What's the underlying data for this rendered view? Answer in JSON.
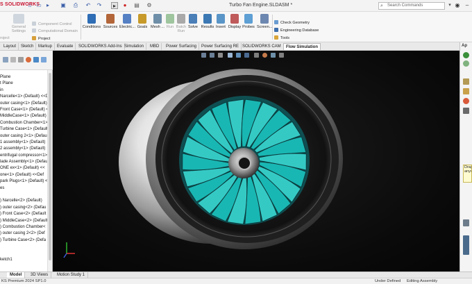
{
  "titlebar": {
    "brand": "S SOLIDWORKS",
    "document_title": "Turbo Fan Engine.SLDASM *",
    "search_placeholder": "Search Commands",
    "quick_access_icons": [
      "home-icon",
      "new-icon",
      "open-icon",
      "save-icon",
      "print-icon",
      "undo-icon",
      "select-icon",
      "rebuild-icon",
      "options-icon"
    ]
  },
  "ribbon": {
    "left_group": {
      "general_settings": "General Settings",
      "project": "Project",
      "component_control": "Component Control",
      "computational_domain": "Computational Domain"
    },
    "buttons": [
      {
        "label": "Conditions",
        "color": "#2f6db5"
      },
      {
        "label": "Sources",
        "color": "#b3663a"
      },
      {
        "label": "Electric...",
        "color": "#5580c4"
      },
      {
        "label": "Goals",
        "color": "#c79a2a"
      },
      {
        "label": "Mesh ...",
        "color": "#6f8fa8"
      },
      {
        "label": "Run",
        "color": "#9ec59e"
      },
      {
        "label": "Batch Run",
        "color": "#a9a9a9"
      },
      {
        "label": "Solve",
        "color": "#4a7fb8"
      },
      {
        "label": "Results",
        "color": "#3c79b4"
      },
      {
        "label": "Insert",
        "color": "#5a95c7"
      },
      {
        "label": "Display",
        "color": "#bf5b5b"
      },
      {
        "label": "Probes",
        "color": "#5e9fd4"
      },
      {
        "label": "Screen...",
        "color": "#6d88b0"
      }
    ],
    "right_group": {
      "check_geometry": "Check Geometry",
      "engineering_database": "Engineering Database",
      "tools": "Tools"
    }
  },
  "tabs": [
    {
      "label": "Layout",
      "active": false
    },
    {
      "label": "Sketch",
      "active": false
    },
    {
      "label": "Markup",
      "active": false
    },
    {
      "label": "Evaluate",
      "active": false
    },
    {
      "label": "SOLIDWORKS Add-Ins",
      "active": false
    },
    {
      "label": "Simulation",
      "active": false
    },
    {
      "label": "MBD",
      "active": false
    },
    {
      "label": "Power Surfacing",
      "active": false
    },
    {
      "label": "Power Surfacing RE",
      "active": false
    },
    {
      "label": "SOLIDWORKS CAM",
      "active": false
    },
    {
      "label": "Flow Simulation",
      "active": true
    }
  ],
  "feature_tree": {
    "items": [
      "Plane",
      "t Plane",
      "in",
      "Narcelle<1> (Default) <<D",
      "outer casing<1> (Default)",
      "Front Case<1> (Default) <",
      "MiddleCase<1> (Default)",
      "Combustion Chamber<1>",
      "Turbine Case<1> (Default)",
      "outer casing 2<1> (Defaul",
      "1 assembly<1> (Default)",
      "2 assembly<1> (Default)",
      "entrifugal compressor<1>",
      "lade Assembly<1> (Default",
      "ONE ex<1> (Default) <<",
      "one<1> (Default) <<Def",
      "park Plugs<1> (Default) <",
      "es",
      "",
      ") Narcelle<2> (Default)",
      ") outer casing<2> (Defau",
      ") Front Case<2> (Default",
      ") MiddleCase<2> (Default",
      ") Combustion Chamber<",
      ") outer casing 2<2> (Def",
      ") Turbine Case<2> (Defa",
      "",
      "",
      "ketch1"
    ]
  },
  "right_panel": {
    "tab_label": "Ap",
    "tooltip": "Drag anyw"
  },
  "bottom_tabs": [
    {
      "label": "Model",
      "active": true
    },
    {
      "label": "3D Views",
      "active": false
    },
    {
      "label": "Motion Study 1",
      "active": false
    }
  ],
  "statusbar": {
    "version": "KS Premium 2024 SP1.0",
    "state": "Under Defined",
    "mode": "Editing Assembly"
  },
  "colors": {
    "fan_teal": "#19b7b3",
    "viewport_bg": "#0b0b0b",
    "brand_red": "#c8102e"
  }
}
